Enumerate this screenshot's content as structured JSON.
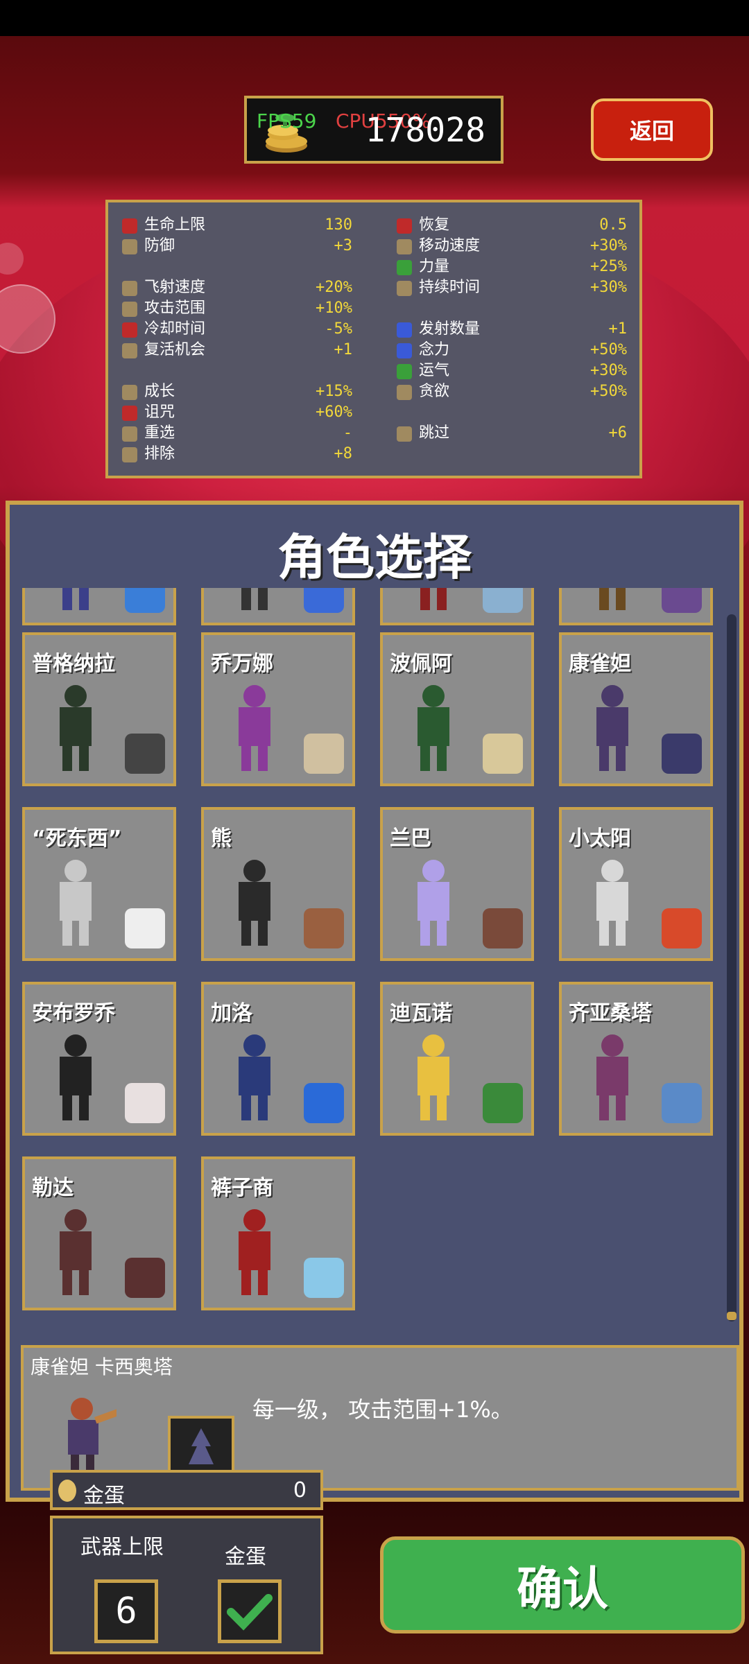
{
  "header": {
    "coins": "178028",
    "fps": "FPS59",
    "cpu": "CPU550%",
    "back_label": "返回"
  },
  "stats": {
    "left": [
      {
        "label": "生命上限",
        "value": "130",
        "icon": "heart-icon"
      },
      {
        "label": "防御",
        "value": "+3",
        "icon": "armor-icon"
      },
      {
        "gap": true
      },
      {
        "label": "飞射速度",
        "value": "+20%",
        "icon": "boot-icon"
      },
      {
        "label": "攻击范围",
        "value": "+10%",
        "icon": "range-icon"
      },
      {
        "label": "冷却时间",
        "value": "-5%",
        "icon": "cooldown-icon"
      },
      {
        "label": "复活机会",
        "value": "+1",
        "icon": "revival-icon"
      },
      {
        "gap": true
      },
      {
        "label": "成长",
        "value": "+15%",
        "icon": "crown-icon"
      },
      {
        "label": "诅咒",
        "value": "+60%",
        "icon": "skull-icon"
      },
      {
        "label": "重选",
        "value": "-",
        "icon": "dice-icon"
      },
      {
        "label": "排除",
        "value": "+8",
        "icon": "banish-icon"
      }
    ],
    "right": [
      {
        "label": "恢复",
        "value": "0.5",
        "icon": "regen-heart-icon"
      },
      {
        "label": "移动速度",
        "value": "+30%",
        "icon": "wing-icon"
      },
      {
        "label": "力量",
        "value": "+25%",
        "icon": "leaf-icon"
      },
      {
        "label": "持续时间",
        "value": "+30%",
        "icon": "hourglass-icon"
      },
      {
        "gap": true
      },
      {
        "label": "发射数量",
        "value": "+1",
        "icon": "amount-icon"
      },
      {
        "label": "念力",
        "value": "+50%",
        "icon": "orb-icon"
      },
      {
        "label": "运气",
        "value": "+30%",
        "icon": "clover-icon"
      },
      {
        "label": "贪欲",
        "value": "+50%",
        "icon": "greed-icon"
      },
      {
        "gap": true
      },
      {
        "label": "跳过",
        "value": "+6",
        "icon": "skip-icon"
      }
    ]
  },
  "panel_title": "角色选择",
  "characters": [
    {
      "name": "",
      "partial": true,
      "color": "#3b3f8a",
      "item": "#3a7ed8"
    },
    {
      "name": "",
      "partial": true,
      "color": "#333",
      "item": "#3a6ad8"
    },
    {
      "name": "",
      "partial": true,
      "color": "#8a2020",
      "item": "#8ab0d0"
    },
    {
      "name": "",
      "partial": true,
      "color": "#6a4a20",
      "item": "#6a4a90"
    },
    {
      "name": "普格纳拉",
      "color": "#2a3a2a",
      "item": "#444"
    },
    {
      "name": "乔万娜",
      "color": "#8a3a9a",
      "item": "#d0c0a0"
    },
    {
      "name": "波佩阿",
      "color": "#2a5a30",
      "item": "#d8c89a"
    },
    {
      "name": "康雀妲",
      "color": "#4a3a6a",
      "item": "#3a3a6a"
    },
    {
      "name": "“死东西”",
      "color": "#c8c8c8",
      "item": "#eee"
    },
    {
      "name": "熊",
      "color": "#2a2a2a",
      "item": "#9a6040"
    },
    {
      "name": "兰巴",
      "color": "#b0a0e8",
      "item": "#7a4a3a"
    },
    {
      "name": "小太阳",
      "color": "#d8d8d8",
      "item": "#d84a2a"
    },
    {
      "name": "安布罗乔",
      "color": "#222",
      "item": "#e8e0e0"
    },
    {
      "name": "加洛",
      "color": "#2a3a7a",
      "item": "#2a6ad8"
    },
    {
      "name": "迪瓦诺",
      "color": "#e8c040",
      "item": "#3a8a3a"
    },
    {
      "name": "齐亚桑塔",
      "color": "#7a3a6a",
      "item": "#5a8ac8"
    },
    {
      "name": "勒达",
      "color": "#5a3030",
      "item": "#5a3030"
    },
    {
      "name": "裤子商",
      "color": "#a02020",
      "item": "#8ac8e8"
    }
  ],
  "description": {
    "name": "康雀妲  卡西奥塔",
    "text": "每一级， 攻击范围+1%。"
  },
  "bottom": {
    "egg_label": "金蛋",
    "egg_value": "0",
    "weapon_limit_label": "武器上限",
    "weapon_limit_value": "6",
    "golden_egg_label": "金蛋",
    "golden_egg_checked": true,
    "confirm_label": "确认"
  },
  "colors": {
    "accent_gold": "#c9a24a",
    "confirm_green": "#3fb04f",
    "back_red": "#c8200e",
    "stat_value_yellow": "#f2d83a"
  }
}
